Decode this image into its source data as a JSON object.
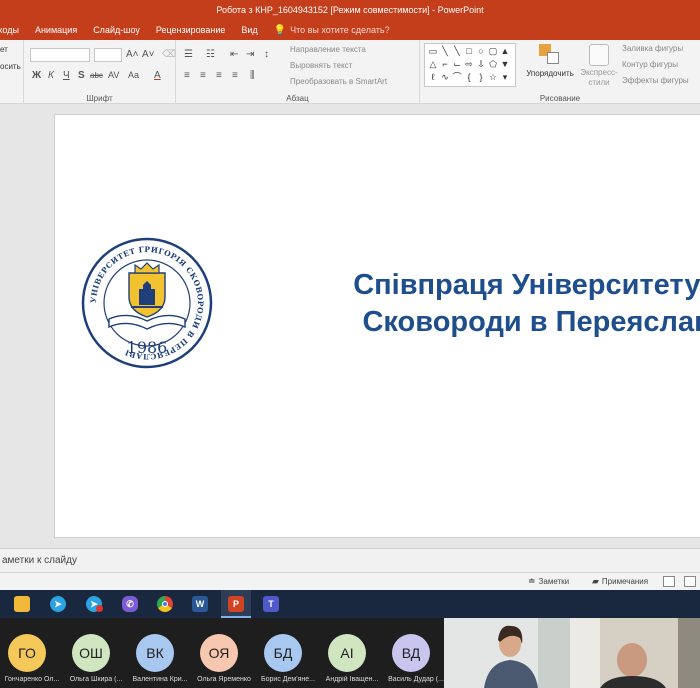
{
  "window": {
    "title": "Робота з КНР_1604943152 [Режим совместимости] - PowerPoint"
  },
  "menu": {
    "tabs": [
      "ходы",
      "Анимация",
      "Слайд-шоу",
      "Рецензирование",
      "Вид"
    ],
    "tell_me": "Что вы хотите сделать?"
  },
  "ribbon": {
    "clipboard": {
      "paste_fragment": "ет",
      "copy_fragment": "осить"
    },
    "font": {
      "label": "Шрифт",
      "format_glyphs": [
        "Ж",
        "К",
        "Ч",
        "S",
        "abc",
        "AV",
        "Aa",
        "A"
      ],
      "grow_glyph": "A˄",
      "shrink_glyph": "A˅"
    },
    "paragraph": {
      "label": "Абзац",
      "text_direction": "Направление текста",
      "align_text": "Выровнять текст",
      "smartart": "Преобразовать в SmartArt"
    },
    "drawing": {
      "label": "Рисование",
      "arrange": "Упорядочить",
      "quick_styles": "Экспресс-стили",
      "fill": "Заливка фигуры",
      "outline": "Контур фигуры",
      "effects": "Эффекты фигуры"
    }
  },
  "slide": {
    "title_line1": "Співпраця Університету Григо",
    "title_line2": "Сковороди в Переяславі із Н",
    "logo": {
      "year": "1986",
      "ring_text": "УНІВЕРСИТЕТ ГРИГОРІЯ СКОВОРОДИ В ПЕРЕЯСЛАВІ"
    }
  },
  "notes": {
    "placeholder": "аметки к слайду"
  },
  "status": {
    "notes_btn": "Заметки",
    "comments_btn": "Примечания"
  },
  "taskbar": {
    "apps": [
      "file-explorer",
      "telegram",
      "telegram-notification",
      "viber",
      "chrome",
      "word",
      "powerpoint",
      "teams"
    ]
  },
  "participants": [
    {
      "initials": "ГО",
      "name": "Гончаренко Ол...",
      "color": "#f5c85a"
    },
    {
      "initials": "ОШ",
      "name": "Ольга Шкира (...",
      "color": "#cfe6c0"
    },
    {
      "initials": "ВК",
      "name": "Валентина Кри...",
      "color": "#a9c8f0"
    },
    {
      "initials": "ОЯ",
      "name": "Ольга Яременко",
      "color": "#f7c7b0"
    },
    {
      "initials": "БД",
      "name": "Борис Дем'яне...",
      "color": "#a9c8f0"
    },
    {
      "initials": "АІ",
      "name": "Андрій Іващен...",
      "color": "#cfe6c0"
    },
    {
      "initials": "ВД",
      "name": "Василь Дудар (...",
      "color": "#c8c6ef"
    }
  ],
  "colors": {
    "accent": "#c43e1c",
    "title_text": "#1f4e8c",
    "taskbar": "#19283f"
  }
}
